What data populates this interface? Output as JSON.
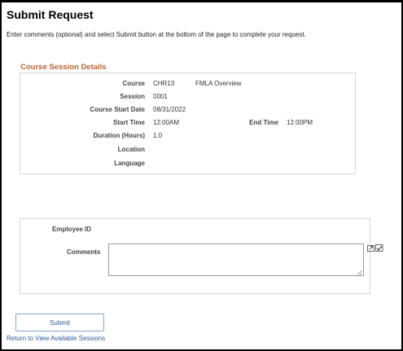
{
  "page": {
    "title": "Submit Request",
    "instructions": "Enter comments (optional) and select Submit button at the bottom of the page to complete your request."
  },
  "course_session_details": {
    "section_title": "Course Session Details",
    "course_label": "Course",
    "course_code": "CHR13",
    "course_name": "FMLA Overview",
    "session_label": "Session",
    "session_value": "0001",
    "start_date_label": "Course Start Date",
    "start_date_value": "08/31/2022",
    "start_time_label": "Start Time",
    "start_time_value": "12:00AM",
    "end_time_label": "End Time",
    "end_time_value": "12:00PM",
    "duration_label": "Duration (Hours)",
    "duration_value": "1.0",
    "location_label": "Location",
    "language_label": "Language"
  },
  "employee": {
    "employee_id_label": "Employee ID",
    "comments_label": "Comments",
    "comments_value": ""
  },
  "actions": {
    "submit_label": "Submit",
    "return_link_label": "Return to View Available Sessions"
  },
  "icons": {
    "expand": "expand-text-icon",
    "resize": "resize-grip-icon"
  },
  "colors": {
    "section_title": "#c0622f",
    "link": "#2b5c94",
    "button_border": "#7fa6cf"
  }
}
